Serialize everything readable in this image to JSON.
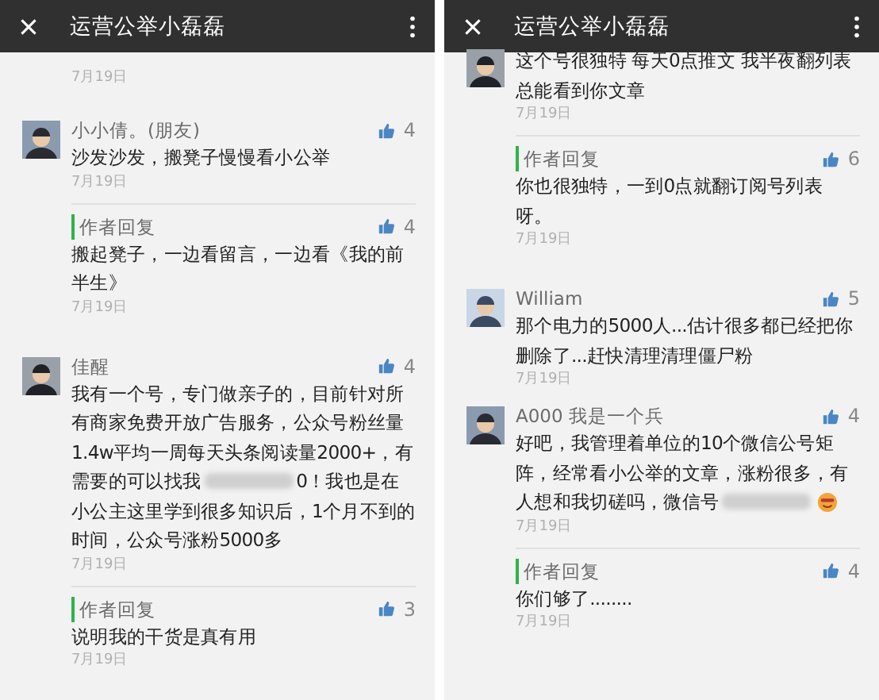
{
  "panels": [
    {
      "title": "运营公举小磊磊",
      "items": [
        {
          "kind": "fragment",
          "date": "7月19日"
        },
        {
          "kind": "comment",
          "name": "小小倩。(朋友)",
          "likes": "4",
          "lines": [
            [
              {
                "kind": "text",
                "value": "沙发沙发，搬凳子慢慢看小公举"
              }
            ]
          ],
          "date": "7月19日"
        },
        {
          "kind": "reply",
          "name": "作者回复",
          "likes": "4",
          "lines": [
            [
              {
                "kind": "text",
                "value": "搬起凳子，一边看留言，一边看《我的前"
              }
            ],
            [
              {
                "kind": "text",
                "value": "半生》"
              }
            ]
          ],
          "date": "7月19日"
        },
        {
          "kind": "comment",
          "name": "佳醒",
          "likes": "4",
          "lines": [
            [
              {
                "kind": "text",
                "value": "我有一个号，专门做亲子的，目前针对所"
              }
            ],
            [
              {
                "kind": "text",
                "value": "有商家免费开放广告服务，公众号粉丝量"
              }
            ],
            [
              {
                "kind": "text",
                "value": "1.4w平均一周每天头条阅读量2000+，有"
              }
            ],
            [
              {
                "kind": "text",
                "value": "需要的可以找我"
              },
              {
                "kind": "blur"
              },
              {
                "kind": "text",
                "value": "0！我也是在"
              }
            ],
            [
              {
                "kind": "text",
                "value": "小公主这里学到很多知识后，1个月不到的"
              }
            ],
            [
              {
                "kind": "text",
                "value": "时间，公众号涨粉5000多"
              }
            ]
          ],
          "date": "7月19日"
        },
        {
          "kind": "reply",
          "name": "作者回复",
          "likes": "3",
          "lines": [
            [
              {
                "kind": "text",
                "value": "说明我的干货是真有用"
              }
            ]
          ],
          "date": "7月19日"
        }
      ]
    },
    {
      "title": "运营公举小磊磊",
      "items": [
        {
          "kind": "comment",
          "lines": [
            [
              {
                "kind": "text",
                "value": "这个号很独特 每天0点推文 我半夜翻列表"
              }
            ],
            [
              {
                "kind": "text",
                "value": "总能看到你文章"
              }
            ]
          ],
          "date": "7月19日"
        },
        {
          "kind": "reply",
          "name": "作者回复",
          "likes": "6",
          "lines": [
            [
              {
                "kind": "text",
                "value": "你也很独特，一到0点就翻订阅号列表"
              }
            ],
            [
              {
                "kind": "text",
                "value": "呀。"
              }
            ]
          ],
          "date": "7月19日"
        },
        {
          "kind": "comment",
          "name": "William",
          "likes": "5",
          "lines": [
            [
              {
                "kind": "text",
                "value": "那个电力的5000人...估计很多都已经把你"
              }
            ],
            [
              {
                "kind": "text",
                "value": "删除了...赶快清理清理僵尸粉"
              }
            ]
          ],
          "date": "7月19日"
        },
        {
          "kind": "comment",
          "name": "A000 我是一个兵",
          "likes": "4",
          "lines": [
            [
              {
                "kind": "text",
                "value": "好吧，我管理着单位的10个微信公号矩"
              }
            ],
            [
              {
                "kind": "text",
                "value": "阵，经常看小公举的文章，涨粉很多，有"
              }
            ],
            [
              {
                "kind": "text",
                "value": "人想和我切磋吗，微信号"
              },
              {
                "kind": "blur"
              },
              {
                "kind": "emoji"
              }
            ]
          ],
          "date": "7月19日"
        },
        {
          "kind": "reply",
          "name": "作者回复",
          "likes": "4",
          "lines": [
            [
              {
                "kind": "text",
                "value": "你们够了........"
              }
            ]
          ],
          "date": "7月19日"
        }
      ]
    }
  ]
}
